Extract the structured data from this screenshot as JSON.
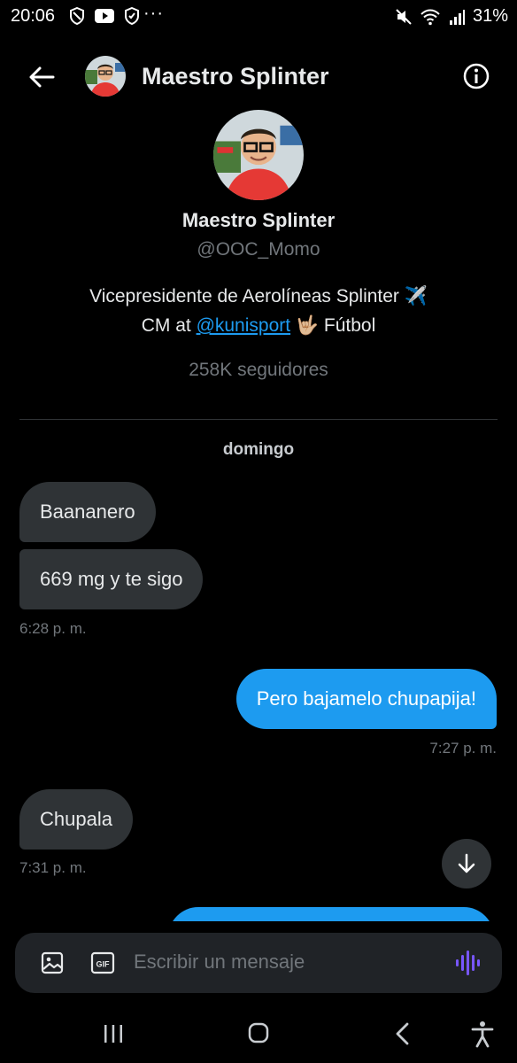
{
  "status_bar": {
    "time": "20:06",
    "more": "···",
    "battery": "31%"
  },
  "header": {
    "title": "Maestro Splinter",
    "icons": [
      "back-arrow-icon",
      "info-icon"
    ]
  },
  "profile": {
    "name": "Maestro Splinter",
    "handle": "@OOC_Momo",
    "bio_line1": "Vicepresidente de Aerolíneas Splinter ✈️",
    "bio_prefix": "CM at ",
    "bio_link": "@kunisport",
    "bio_suffix": " 🤟🏼 Fútbol",
    "followers": "258K seguidores"
  },
  "conversation": {
    "day_label": "domingo",
    "messages": [
      {
        "direction": "in",
        "text": "Baananero"
      },
      {
        "direction": "in",
        "text": "669 mg y te sigo",
        "time": "6:28 p. m."
      },
      {
        "direction": "out",
        "text": "Pero bajamelo chupapija!",
        "time": "7:27 p. m."
      },
      {
        "direction": "in",
        "text": "Chupala",
        "time": "7:31 p. m."
      }
    ]
  },
  "composer": {
    "placeholder": "Escribir un mensaje",
    "icons": [
      "image-icon",
      "gif-icon",
      "voice-icon"
    ]
  },
  "colors": {
    "accent": "#1d9bf0",
    "incoming_bubble": "#2f3336",
    "background": "#000000",
    "muted_text": "#71767b",
    "voice_icon": "#7856ff"
  }
}
